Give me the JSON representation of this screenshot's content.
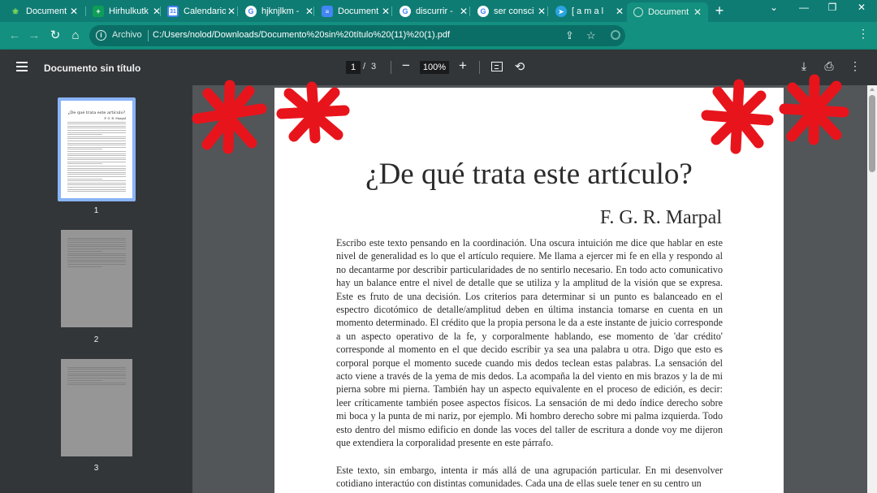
{
  "browser": {
    "tabs": [
      {
        "title": "Document",
        "icon": "leaf-icon",
        "color": "#34a853"
      },
      {
        "title": "Hirhulkutk",
        "icon": "sheets-icon",
        "color": "#0f9d58"
      },
      {
        "title": "Calendario",
        "icon": "calendar-icon",
        "color": "#4285f4"
      },
      {
        "title": "hjknjlkm -",
        "icon": "google-icon",
        "color": "#ffffff"
      },
      {
        "title": "Document",
        "icon": "docs-icon",
        "color": "#4285f4"
      },
      {
        "title": "discurrir -",
        "icon": "google-icon",
        "color": "#ffffff"
      },
      {
        "title": "ser consci",
        "icon": "google-icon",
        "color": "#ffffff"
      },
      {
        "title": "[ a m a l",
        "icon": "telegram-icon",
        "color": "#2aa3e0"
      },
      {
        "title": "Document",
        "icon": "globe-icon",
        "color": "#bfe3dd"
      }
    ],
    "new_tab": "+",
    "omnibox": {
      "chip": "Archivo",
      "url": "C:/Users/nolod/Downloads/Documento%20sin%20título%20(11)%20(1).pdf"
    }
  },
  "pdf_toolbar": {
    "title": "Documento sin título",
    "current_page": "1",
    "separator": "/",
    "total_pages": "3",
    "zoom": "100%"
  },
  "thumbnails": [
    {
      "number": "1",
      "title": "¿De qué trata este artículo?",
      "author": "F. G. R. Marpal"
    },
    {
      "number": "2"
    },
    {
      "number": "3"
    }
  ],
  "document": {
    "title": "¿De qué trata este artículo?",
    "author": "F. G. R. Marpal",
    "paragraph1": "Escribo este texto pensando en la coordinación. Una oscura intuición me dice que hablar en este nivel de generalidad es lo que el artículo requiere. Me llama a ejercer mi fe en ella y respondo al no decantarme por describir particularidades de no sentirlo necesario. En todo acto comunicativo hay un balance entre el nivel de detalle que se utiliza y la amplitud de la visión que se expresa. Este es fruto de una decisión. Los criterios para determinar si un punto es balanceado en el espectro dicotómico de detalle/amplitud deben en última instancia tomarse en cuenta en un momento determinado. El crédito que la propia persona le da a este instante de juicio corresponde a un aspecto operativo de la fe, y corporalmente hablando, ese momento de 'dar crédito' corresponde al momento en el que decido escribir ya sea una palabra u otra. Digo que esto es corporal porque el momento sucede cuando mis dedos teclean estas palabras. La sensación del acto viene a través de la yema de mis dedos. La acompaña la del viento en mis brazos y la de mi pierna sobre mi pierna. También hay un aspecto equivalente en el proceso de edición, es decir: leer críticamente también posee aspectos físicos. La sensación de mi dedo índice derecho sobre mi boca y la punta de mi nariz, por ejemplo. Mi hombro derecho sobre mi palma izquierda. Todo esto dentro del mismo edificio en donde las voces del taller de escritura a donde voy me dijeron que extendiera la corporalidad presente en este párrafo.",
    "paragraph2": "Este texto, sin embargo, intenta ir más allá de una agrupación particular. En mi desenvolver cotidiano interactúo con distintas comunidades. Cada una de ellas suele tener en su centro un"
  },
  "colors": {
    "tabstrip": "#0f7c74",
    "toolbar": "#323639",
    "viewer_bg": "#525659",
    "annotation": "#e8141c"
  }
}
